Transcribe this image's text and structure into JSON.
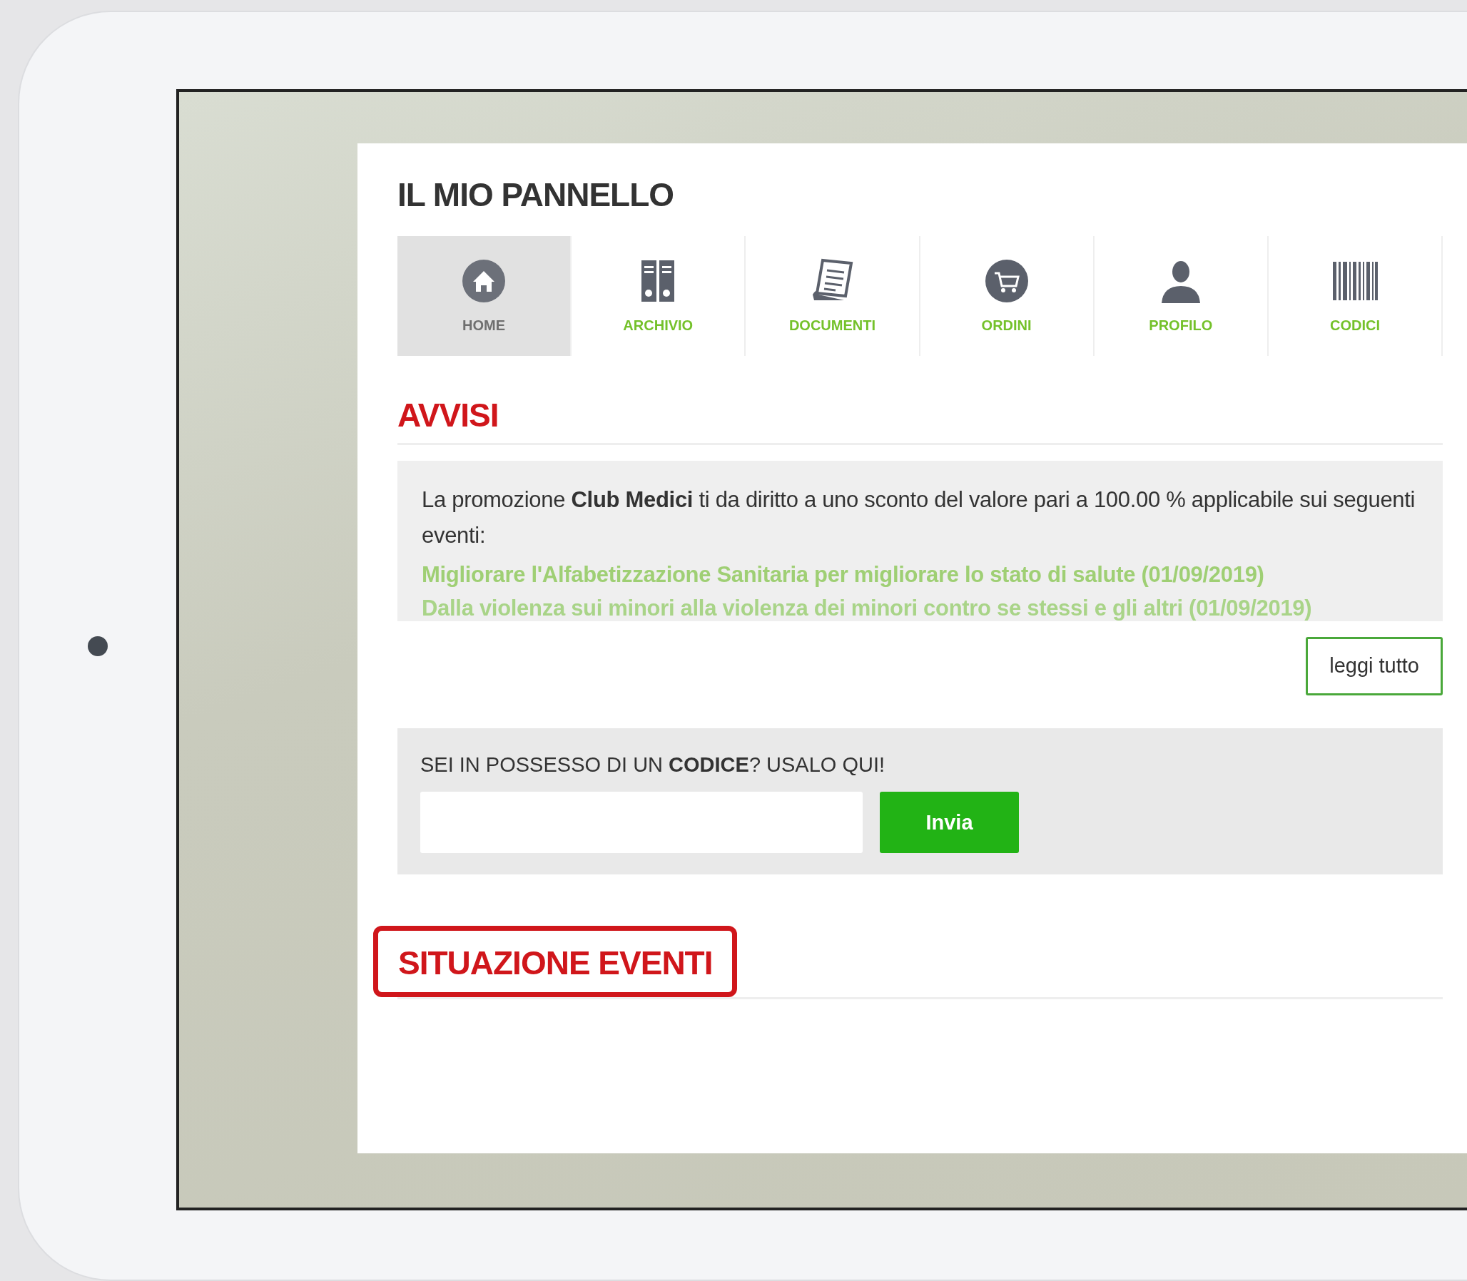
{
  "page_title": "IL MIO PANNELLO",
  "tabs": [
    {
      "label": "HOME",
      "selected": true
    },
    {
      "label": "ARCHIVIO",
      "selected": false
    },
    {
      "label": "DOCUMENTI",
      "selected": false
    },
    {
      "label": "ORDINI",
      "selected": false
    },
    {
      "label": "PROFILO",
      "selected": false
    },
    {
      "label": "CODICI",
      "selected": false
    }
  ],
  "notices": {
    "heading": "AVVISI",
    "message": "La promozione **Club Medici** ti da diritto a uno sconto del valore pari a 100.00 % applicabile sui seguenti eventi:",
    "events": [
      "Migliorare l'Alfabetizzazione Sanitaria per migliorare lo stato di salute (01/09/2019)",
      "Dalla violenza sui minori alla violenza dei minori contro se stessi e gli altri (01/09/2019)"
    ],
    "read_more_button": "leggi tutto"
  },
  "code_form": {
    "prompt": "SEI IN POSSESSO DI UN **CODICE**? USALO QUI!",
    "submit_button": "Invia"
  },
  "events_section": {
    "heading": "SITUAZIONE EVENTI",
    "highlighted": true
  }
}
